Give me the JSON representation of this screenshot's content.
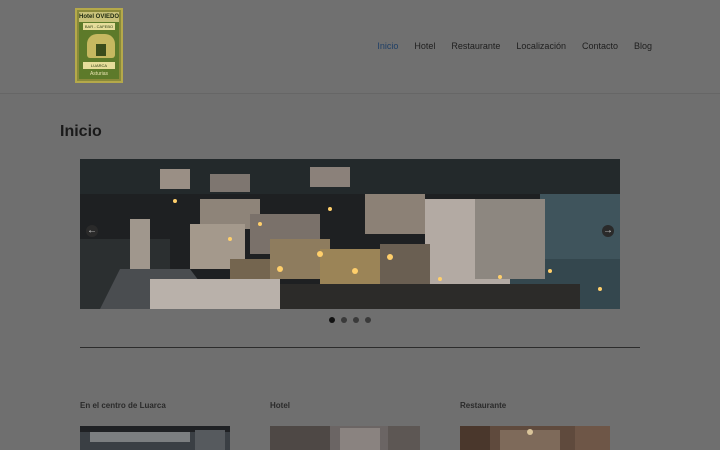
{
  "logo": {
    "title": "Hotel OVIEDO",
    "subtitle": "BAR - CAFEBO",
    "band": "LUARCA",
    "footer": "Asturias"
  },
  "nav": {
    "items": [
      {
        "label": "Inicio",
        "active": true
      },
      {
        "label": "Hotel",
        "active": false
      },
      {
        "label": "Restaurante",
        "active": false
      },
      {
        "label": "Localización",
        "active": false
      },
      {
        "label": "Contacto",
        "active": false
      },
      {
        "label": "Blog",
        "active": false
      }
    ]
  },
  "page": {
    "title": "Inicio"
  },
  "slider": {
    "prev_icon": "arrow-left-icon",
    "next_icon": "arrow-right-icon",
    "dots": 4,
    "active_dot": 1
  },
  "sections": [
    {
      "title": "En el centro de Luarca"
    },
    {
      "title": "Hotel"
    },
    {
      "title": "Restaurante"
    }
  ],
  "colors": {
    "overlay_bg": "#6f6f6f",
    "nav_active": "#1f3f66"
  }
}
